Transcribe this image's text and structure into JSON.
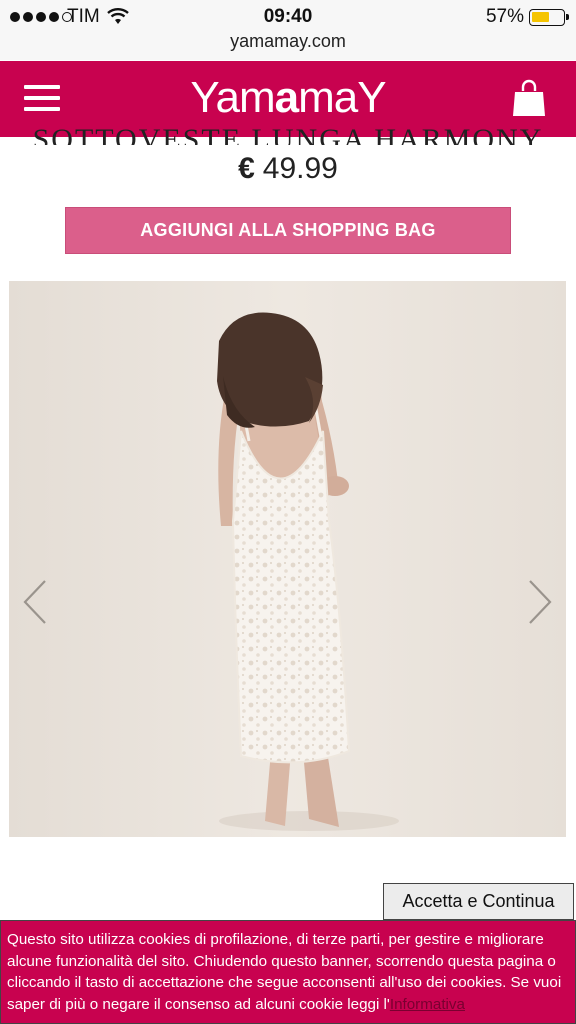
{
  "status_bar": {
    "carrier": "TIM",
    "time": "09:40",
    "battery_percent": "57%",
    "battery_level": 0.57,
    "url": "yamamay.com"
  },
  "header": {
    "logo_pre": "Yam",
    "logo_bold": "a",
    "logo_post": "maY",
    "brand_color": "#c8024f",
    "menu_icon": "hamburger-icon",
    "bag_icon": "shopping-bag-icon"
  },
  "product": {
    "title": "SOTTOVESTE LUNGA HARMONY",
    "currency": "€",
    "price": "49.99",
    "add_to_bag_label": "AGGIUNGI ALLA SHOPPING BAG",
    "button_color": "#db5f8b"
  },
  "gallery": {
    "prev_icon": "chevron-left-icon",
    "next_icon": "chevron-right-icon"
  },
  "cookie": {
    "accept_label": "Accetta e Continua",
    "text": "Questo sito utilizza cookies di profilazione, di terze parti, per gestire e migliorare alcune funzionalità del sito. Chiudendo questo banner, scorrendo questa pagina o cliccando il tasto di accettazione che segue acconsenti all'uso dei cookies. Se vuoi saper di più o negare il consenso ad alcuni cookie leggi l'",
    "link_text": "Informativa"
  }
}
